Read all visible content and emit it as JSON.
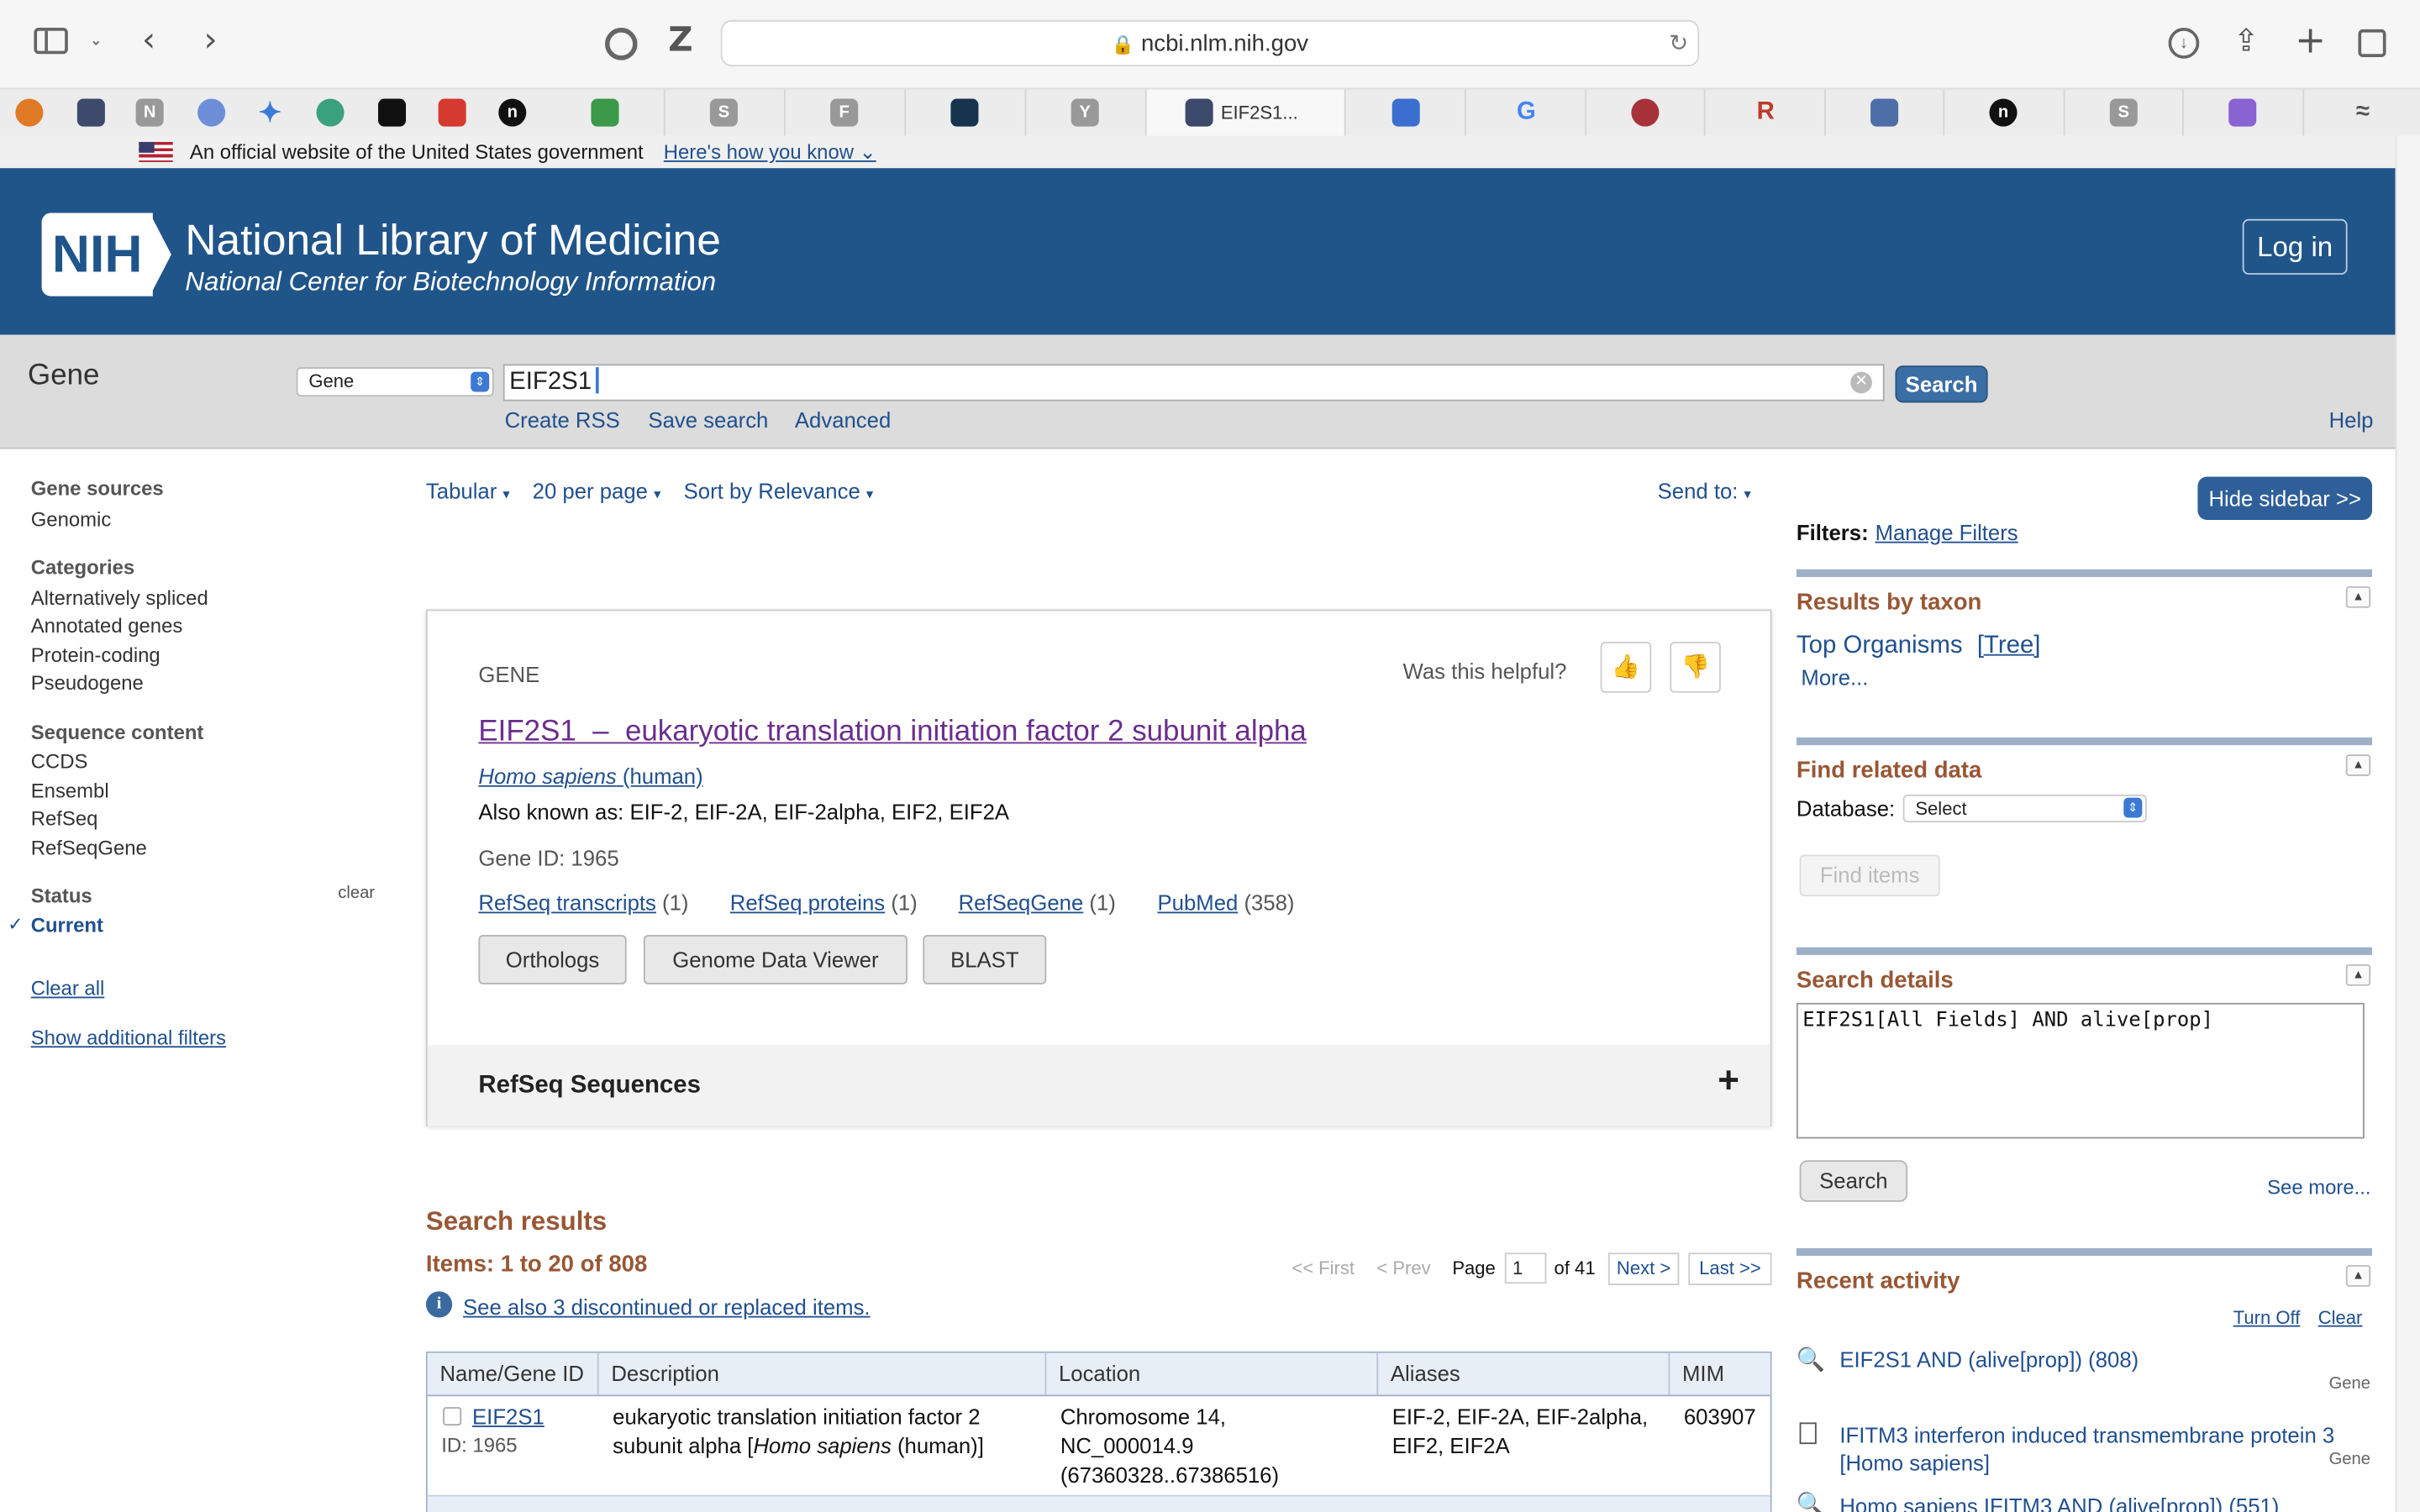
{
  "browser": {
    "url": "ncbi.nlm.nih.gov",
    "active_tab": "EIF2S1..."
  },
  "gov_banner": {
    "text": "An official website of the United States government",
    "link": "Here's how you know"
  },
  "header": {
    "logo": "NIH",
    "title": "National Library of Medicine",
    "subtitle": "National Center for Biotechnology Information",
    "login": "Log in"
  },
  "search": {
    "db_label": "Gene",
    "db_value": "Gene",
    "query": "EIF2S1",
    "button": "Search",
    "links": [
      "Create RSS",
      "Save search",
      "Advanced"
    ],
    "help": "Help"
  },
  "sidebar_left": {
    "gene_sources_h": "Gene sources",
    "gene_sources": [
      "Genomic"
    ],
    "categories_h": "Categories",
    "categories": [
      "Alternatively spliced",
      "Annotated genes",
      "Protein-coding",
      "Pseudogene"
    ],
    "sequence_h": "Sequence content",
    "sequence": [
      "CCDS",
      "Ensembl",
      "RefSeq",
      "RefSeqGene"
    ],
    "status_h": "Status",
    "status_clear": "clear",
    "status_current": "Current",
    "clear_all": "Clear all",
    "show_more": "Show additional filters"
  },
  "toolbar": {
    "format": "Tabular",
    "per_page": "20 per page",
    "sort": "Sort by Relevance",
    "send_to": "Send to:"
  },
  "card": {
    "label": "GENE",
    "helpful": "Was this helpful?",
    "title": "EIF2S1  –  eukaryotic translation initiation factor 2 subunit alpha",
    "organism_italic": "Homo sapiens",
    "organism_common": "(human)",
    "aliases": "Also known as: EIF-2, EIF-2A, EIF-2alpha, EIF2, EIF2A",
    "gene_id": "Gene ID: 1965",
    "links": [
      {
        "label": "RefSeq transcripts",
        "count": "(1)"
      },
      {
        "label": "RefSeq proteins",
        "count": "(1)"
      },
      {
        "label": "RefSeqGene",
        "count": "(1)"
      },
      {
        "label": "PubMed",
        "count": "(358)"
      }
    ],
    "buttons": [
      "Orthologs",
      "Genome Data Viewer",
      "BLAST"
    ],
    "refseq": "RefSeq Sequences"
  },
  "results": {
    "heading": "Search results",
    "items": "Items: 1 to 20 of 808",
    "see_also": "See also 3 discontinued or replaced items.",
    "first": "<< First",
    "prev": "< Prev",
    "page_label": "Page",
    "page": "1",
    "of": "of 41",
    "next": "Next >",
    "last": "Last >>",
    "columns": [
      "Name/Gene ID",
      "Description",
      "Location",
      "Aliases",
      "MIM"
    ],
    "rows": [
      {
        "name": "EIF2S1",
        "id": "ID: 1965",
        "desc1": "eukaryotic translation initiation factor 2",
        "desc2_pre": "subunit alpha [",
        "desc2_it": "Homo sapiens",
        "desc2_post": " (human)]",
        "loc1": "Chromosome 14,",
        "loc2": "NC_000014.9",
        "loc3": "(67360328..67386516)",
        "alias1": "EIF-2, EIF-2A, EIF-2alpha,",
        "alias2": "EIF2, EIF2A",
        "mim": "603907"
      }
    ]
  },
  "sidebar_right": {
    "hide": "Hide sidebar >>",
    "filters": "Filters:",
    "manage": "Manage Filters",
    "taxon_h": "Results by taxon",
    "top_org": "Top Organisms",
    "tree": "[Tree]",
    "more": "More...",
    "related_h": "Find related data",
    "database_label": "Database:",
    "database_value": "Select",
    "find_items": "Find items",
    "details_h": "Search details",
    "details_query": "EIF2S1[All Fields] AND alive[prop]",
    "details_search": "Search",
    "see_more": "See more...",
    "activity_h": "Recent activity",
    "turn_off": "Turn Off",
    "clear": "Clear",
    "activity": [
      {
        "text": "EIF2S1 AND (alive[prop]) (808)",
        "type": "Gene"
      },
      {
        "text": "IFITM3 interferon induced transmembrane protein 3 [Homo sapiens]",
        "type": "Gene"
      },
      {
        "text": "Homo sapiens IFITM3 AND (alive[prop]) (551)",
        "type": ""
      }
    ]
  }
}
